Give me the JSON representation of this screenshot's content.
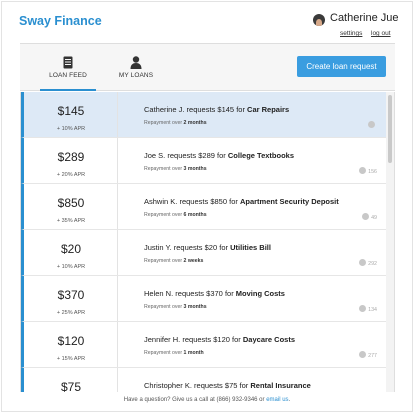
{
  "header": {
    "brand": "Sway Finance",
    "user_name": "Catherine Jue",
    "settings_label": "settings",
    "logout_label": "log out"
  },
  "toolbar": {
    "tabs": [
      {
        "label": "LOAN FEED",
        "icon": "document-icon",
        "active": true
      },
      {
        "label": "MY LOANS",
        "icon": "person-icon",
        "active": false
      }
    ],
    "create_label": "Create loan request"
  },
  "loans": [
    {
      "amount": "$145",
      "apr": "+ 10% APR",
      "name": "Catherine J.",
      "requests": "requests",
      "req_amount": "$145",
      "for": "for",
      "purpose": "Car Repairs",
      "repay_prefix": "Repayment over",
      "term": "2 months",
      "score": "",
      "selected": true
    },
    {
      "amount": "$289",
      "apr": "+ 20% APR",
      "name": "Joe S.",
      "requests": "requests",
      "req_amount": "$289",
      "for": "for",
      "purpose": "College Textbooks",
      "repay_prefix": "Repayment over",
      "term": "3 months",
      "score": "156",
      "selected": false
    },
    {
      "amount": "$850",
      "apr": "+ 35% APR",
      "name": "Ashwin K.",
      "requests": "requests",
      "req_amount": "$850",
      "for": "for",
      "purpose": "Apartment Security Deposit",
      "repay_prefix": "Repayment over",
      "term": "6 months",
      "score": "49",
      "selected": false
    },
    {
      "amount": "$20",
      "apr": "+ 10% APR",
      "name": "Justin Y.",
      "requests": "requests",
      "req_amount": "$20",
      "for": "for",
      "purpose": "Utilities Bill",
      "repay_prefix": "Repayment over",
      "term": "2 weeks",
      "score": "292",
      "selected": false
    },
    {
      "amount": "$370",
      "apr": "+ 25% APR",
      "name": "Helen N.",
      "requests": "requests",
      "req_amount": "$370",
      "for": "for",
      "purpose": "Moving Costs",
      "repay_prefix": "Repayment over",
      "term": "3 months",
      "score": "134",
      "selected": false
    },
    {
      "amount": "$120",
      "apr": "+ 15% APR",
      "name": "Jennifer H.",
      "requests": "requests",
      "req_amount": "$120",
      "for": "for",
      "purpose": "Daycare Costs",
      "repay_prefix": "Repayment over",
      "term": "1 month",
      "score": "277",
      "selected": false
    },
    {
      "amount": "$75",
      "apr": "",
      "name": "Christopher K.",
      "requests": "requests",
      "req_amount": "$75",
      "for": "for",
      "purpose": "Rental Insurance",
      "repay_prefix": "",
      "term": "",
      "score": "",
      "selected": false
    }
  ],
  "footer": {
    "text": "Have a question? Give us a call at (866) 932-9346 or",
    "link": "email us",
    "end": "."
  },
  "colors": {
    "accent": "#2a8fd0",
    "button": "#3a9de0",
    "selected_row": "#dde9f6"
  }
}
